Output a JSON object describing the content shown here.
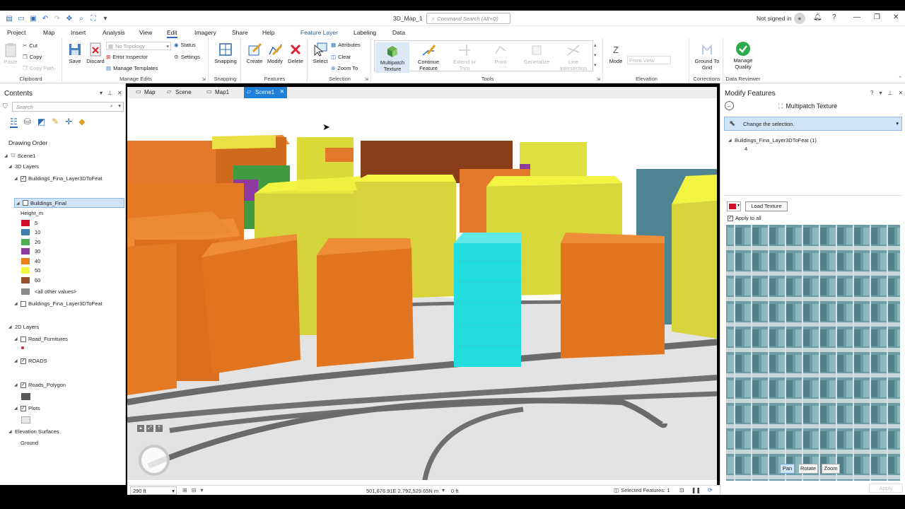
{
  "window": {
    "project_title": "3D_Map_1",
    "command_search_placeholder": "Command Search (Alt+Q)",
    "user": "Not signed in"
  },
  "menu": [
    "Project",
    "Map",
    "Insert",
    "Analysis",
    "View",
    "Edit",
    "Imagery",
    "Share",
    "Help"
  ],
  "active_menu": "Edit",
  "context_tabs": {
    "group": "Feature Layer",
    "tabs": [
      "Labeling",
      "Data"
    ]
  },
  "ribbon": {
    "clipboard": {
      "label": "Clipboard",
      "paste": "Paste",
      "cut": "Cut",
      "copy": "Copy",
      "copy_path": "Copy Path"
    },
    "manage_edits": {
      "label": "Manage Edits",
      "save": "Save",
      "discard": "Discard",
      "topology": "No Topology",
      "status": "Status",
      "error_inspector": "Error Inspector",
      "settings": "Settings",
      "manage_templates": "Manage Templates"
    },
    "snapping": {
      "label": "Snapping",
      "snapping": "Snapping"
    },
    "features": {
      "label": "Features",
      "create": "Create",
      "modify": "Modify",
      "delete": "Delete"
    },
    "selection": {
      "label": "Selection",
      "select": "Select",
      "attributes": "Attributes",
      "clear": "Clear",
      "zoom_to": "Zoom To"
    },
    "tools": {
      "label": "Tools",
      "multipatch_texture": "Multipatch Texture",
      "continue_feature": "Continue Feature",
      "extend_trim": "Extend or Trim",
      "point": "Point",
      "generalize": "Generalize",
      "line_intersection": "Line Intersection"
    },
    "elevation": {
      "label": "Elevation",
      "mode": "Mode",
      "from_view": "From View"
    },
    "corrections": {
      "label": "Corrections",
      "ground_to_grid": "Ground To Grid"
    },
    "data_reviewer": {
      "label": "Data Reviewer",
      "manage_quality": "Manage Quality"
    }
  },
  "contents": {
    "title": "Contents",
    "search_placeholder": "Search",
    "drawing_order": "Drawing Order",
    "scene": "Scene1",
    "layers_3d": "3D Layers",
    "layer_feat": "Buildings_Fina_Layer3DToFeat",
    "layer_final": "Buildings_Final",
    "legend_field": "Height_m",
    "legend": [
      {
        "label": "5",
        "color": "#d0102a"
      },
      {
        "label": "10",
        "color": "#3e7fb2"
      },
      {
        "label": "20",
        "color": "#4caf50"
      },
      {
        "label": "30",
        "color": "#8e3a9e"
      },
      {
        "label": "40",
        "color": "#ef7d1a"
      },
      {
        "label": "50",
        "color": "#f3f342"
      },
      {
        "label": "60",
        "color": "#9c4f2c"
      },
      {
        "label": "<all other values>",
        "color": "#8a8a8a"
      }
    ],
    "layer_feat2": "Buildings_Fina_Layer3DToFeat",
    "layers_2d": "2D Layers",
    "road_furnitures": "Road_Furnitures",
    "roads": "ROADS",
    "roads_polygon": "Roads_Polygon",
    "plots": "Plots",
    "elevation_surfaces": "Elevation Surfaces",
    "ground": "Ground"
  },
  "view_tabs": [
    "Map",
    "Scene",
    "Map1",
    "Scene1"
  ],
  "active_view_tab": "Scene1",
  "status": {
    "scale": "290 ft",
    "coords": "501,676.91E 2,792,529.65N m",
    "elev": "0 ft",
    "selected": "Selected Features: 1"
  },
  "modify": {
    "title": "Modify Features",
    "tool": "Multipatch Texture",
    "selection_prompt": "Change the selection.",
    "tree_layer": "Buildings_Fina_Layer3DToFeat (1)",
    "tree_item": "4",
    "load_texture": "Load Texture",
    "apply_to_all": "Apply to all",
    "pan": "Pan",
    "rotate": "Rotate",
    "zoom": "Zoom",
    "apply": "Apply",
    "texture_color": "#d0102a"
  }
}
